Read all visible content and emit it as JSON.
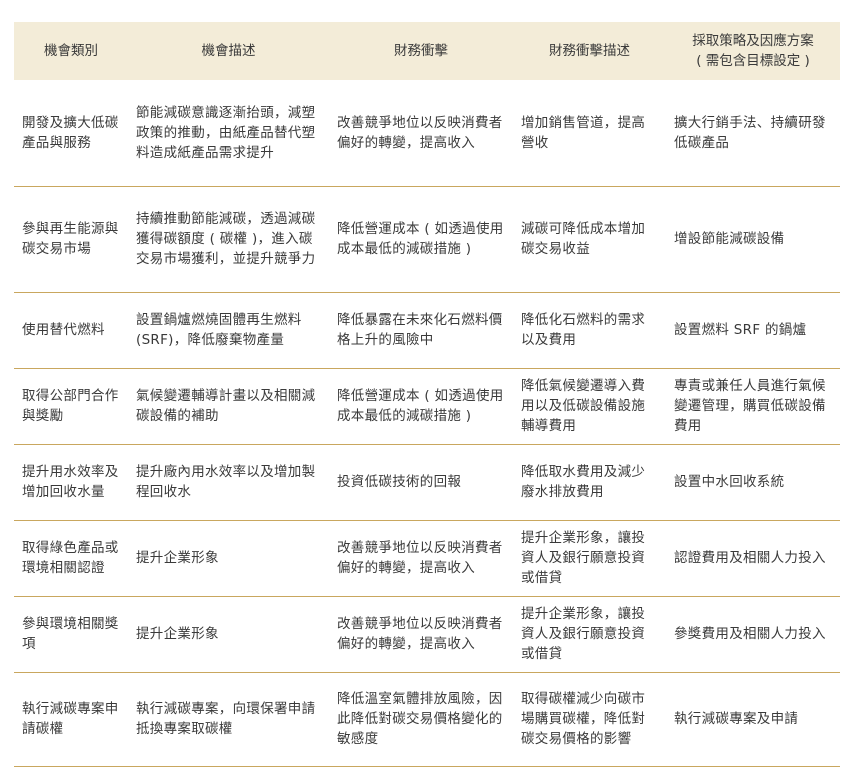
{
  "header": {
    "col1": "機會類別",
    "col2": "機會描述",
    "col3": "財務衝擊",
    "col4": "財務衝擊描述",
    "col5_line1": "採取策略及因應方案",
    "col5_line2": "( 需包含目標設定 )"
  },
  "rows": [
    {
      "category": "開發及擴大低碳產品與服務",
      "description": "節能減碳意識逐漸抬頭，減塑政策的推動，由紙產品替代塑料造成紙產品需求提升",
      "impact": "改善競爭地位以反映消費者偏好的轉變，提高收入",
      "impact_desc": "增加銷售管道，提高營收",
      "strategy": "擴大行銷手法、持續研發低碳產品"
    },
    {
      "category": "參與再生能源與碳交易市場",
      "description": "持續推動節能減碳，透過減碳獲得碳額度 ( 碳權 )，進入碳交易市場獲利，並提升競爭力",
      "impact": "降低營運成本 ( 如透過使用成本最低的減碳措施 )",
      "impact_desc": "減碳可降低成本增加碳交易收益",
      "strategy": "增設節能減碳設備"
    },
    {
      "category": "使用替代燃料",
      "description": "設置鍋爐燃燒固體再生燃料 (SRF)，降低廢棄物產量",
      "impact": "降低暴露在未來化石燃料價格上升的風險中",
      "impact_desc": "降低化石燃料的需求以及費用",
      "strategy": "設置燃料 SRF 的鍋爐"
    },
    {
      "category": "取得公部門合作與獎勵",
      "description": "氣候變遷輔導計畫以及相關減碳設備的補助",
      "impact": "降低營運成本 ( 如透過使用成本最低的減碳措施 )",
      "impact_desc": "降低氣候變遷導入費用以及低碳設備設施輔導費用",
      "strategy": "專責或兼任人員進行氣候變遷管理，購買低碳設備費用"
    },
    {
      "category": "提升用水效率及增加回收水量",
      "description": "提升廠內用水效率以及增加製程回收水",
      "impact": "投資低碳技術的回報",
      "impact_desc": "降低取水費用及減少廢水排放費用",
      "strategy": "設置中水回收系統"
    },
    {
      "category": "取得綠色產品或環境相關認證",
      "description": "提升企業形象",
      "impact": "改善競爭地位以反映消費者偏好的轉變，提高收入",
      "impact_desc": "提升企業形象，讓投資人及銀行願意投資或借貸",
      "strategy": "認證費用及相關人力投入"
    },
    {
      "category": "參與環境相關獎項",
      "description": "提升企業形象",
      "impact": "改善競爭地位以反映消費者偏好的轉變，提高收入",
      "impact_desc": "提升企業形象，讓投資人及銀行願意投資或借貸",
      "strategy": "參獎費用及相關人力投入"
    },
    {
      "category": "執行減碳專案申請碳權",
      "description": "執行減碳專案，向環保署申請抵換專案取碳權",
      "impact": "降低溫室氣體排放風險，因此降低對碳交易價格變化的敏感度",
      "impact_desc": "取得碳權減少向碳市場購買碳權，降低對碳交易價格的影響",
      "strategy": "執行減碳專案及申請"
    }
  ]
}
